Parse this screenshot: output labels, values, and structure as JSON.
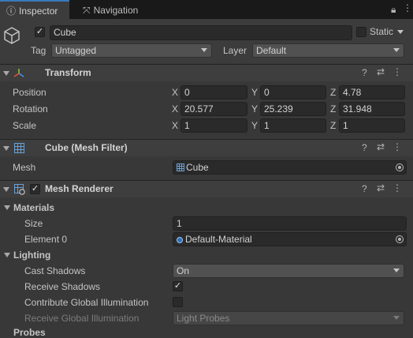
{
  "tabs": {
    "inspector": "Inspector",
    "navigation": "Navigation"
  },
  "header": {
    "name": "Cube",
    "active": true,
    "static_label": "Static",
    "static": false,
    "tag_label": "Tag",
    "tag_value": "Untagged",
    "layer_label": "Layer",
    "layer_value": "Default"
  },
  "transform": {
    "title": "Transform",
    "rows": [
      {
        "label": "Position",
        "x": "0",
        "y": "0",
        "z": "4.78"
      },
      {
        "label": "Rotation",
        "x": "20.577",
        "y": "25.239",
        "z": "31.948"
      },
      {
        "label": "Scale",
        "x": "1",
        "y": "1",
        "z": "1"
      }
    ],
    "axes": {
      "x": "X",
      "y": "Y",
      "z": "Z"
    }
  },
  "mesh_filter": {
    "title": "Cube (Mesh Filter)",
    "mesh_label": "Mesh",
    "mesh_value": "Cube"
  },
  "mesh_renderer": {
    "title": "Mesh Renderer",
    "enabled": true,
    "materials_label": "Materials",
    "size_label": "Size",
    "size_value": "1",
    "element0_label": "Element 0",
    "element0_value": "Default-Material",
    "lighting_label": "Lighting",
    "cast_shadows_label": "Cast Shadows",
    "cast_shadows_value": "On",
    "receive_shadows_label": "Receive Shadows",
    "receive_shadows": true,
    "contribute_gi_label": "Contribute Global Illumination",
    "contribute_gi": false,
    "receive_gi_label": "Receive Global Illumination",
    "receive_gi_value": "Light Probes",
    "probes_label": "Probes"
  },
  "colors": {
    "accent": "#3a79bb",
    "background": "#383838",
    "field": "#2a2a2a"
  }
}
